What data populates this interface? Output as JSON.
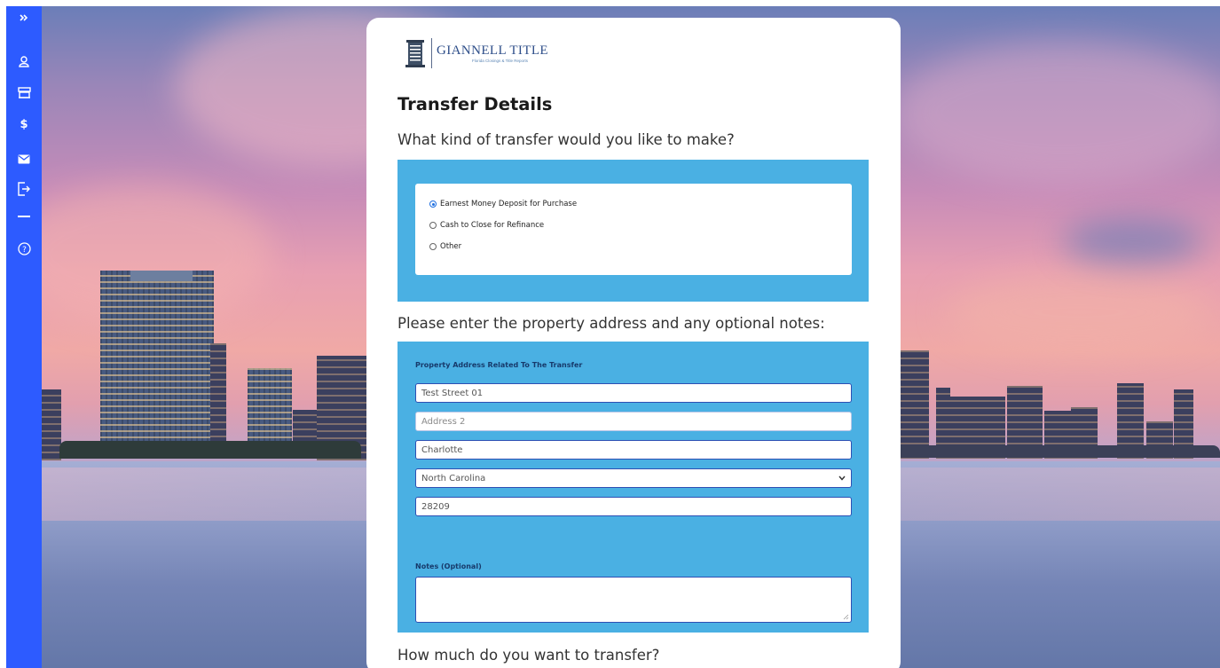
{
  "sidebar": {
    "items": [
      {
        "icon": "double-chevron-right-icon"
      },
      {
        "icon": "user-icon"
      },
      {
        "icon": "building-icon"
      },
      {
        "icon": "dollar-icon"
      },
      {
        "icon": "mail-icon"
      },
      {
        "icon": "logout-icon"
      },
      {
        "icon": "help-icon"
      }
    ]
  },
  "logo": {
    "brand": "GIANNELL TITLE",
    "tagline": "Florida Closings & Title Reports"
  },
  "form": {
    "title": "Transfer Details",
    "q1": "What kind of transfer would you like to make?",
    "transfer_options": [
      {
        "label": "Earnest Money Deposit for Purchase",
        "checked": true
      },
      {
        "label": "Cash to Close for Refinance",
        "checked": false
      },
      {
        "label": "Other",
        "checked": false
      }
    ],
    "q2": "Please enter the property address and any optional notes:",
    "address_label": "Property Address Related To The Transfer",
    "address1": "Test Street 01",
    "address2_placeholder": "Address 2",
    "city": "Charlotte",
    "state": "North Carolina",
    "zip": "28209",
    "notes_label": "Notes (Optional)",
    "notes": "",
    "q3": "How much do you want to transfer?"
  },
  "colors": {
    "sidebar": "#2d5bff",
    "panel": "#4ab0e3",
    "input_border": "#2d4fb3",
    "label": "#173a6b"
  }
}
